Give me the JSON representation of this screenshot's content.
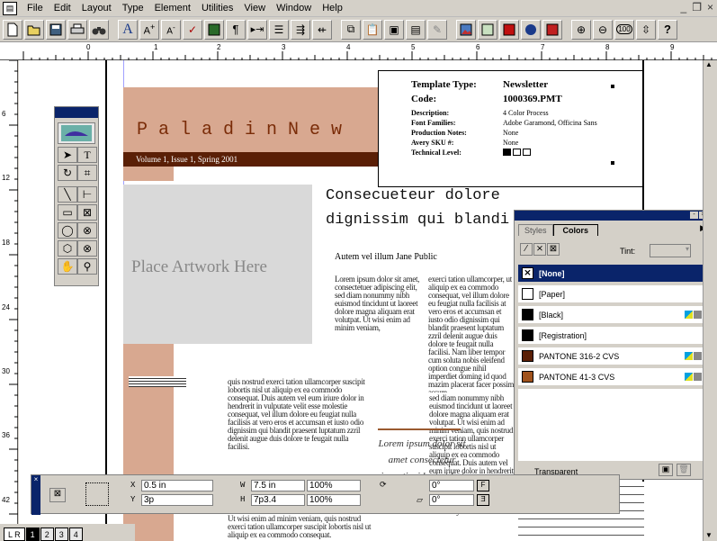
{
  "menubar": {
    "items": [
      "File",
      "Edit",
      "Layout",
      "Type",
      "Element",
      "Utilities",
      "View",
      "Window",
      "Help"
    ],
    "window_controls": [
      "_",
      "❐",
      "×"
    ]
  },
  "toolbar": {
    "buttons": [
      "new-document",
      "open",
      "save",
      "print",
      "find",
      "font",
      "increase-size",
      "decrease-size",
      "spelling",
      "frame",
      "paragraph-mark",
      "tab",
      "list",
      "indent",
      "outdent",
      "copy",
      "paste",
      "view",
      "layers",
      "magnify-1",
      "link",
      "image",
      "color",
      "record",
      "zoom-in",
      "zoom-out",
      "100",
      "navigate",
      "help"
    ],
    "zoom_label": "100",
    "help_label": "?"
  },
  "ruler": {
    "h_labels": [
      "0",
      "1",
      "2",
      "3",
      "4",
      "5",
      "6",
      "7",
      "8",
      "9"
    ],
    "v_labels": [
      "6",
      "12",
      "18",
      "24",
      "30",
      "36",
      "42"
    ]
  },
  "document": {
    "masthead": "PaladinNew",
    "issue_line": "Volume 1, Issue 1, Spring 2001",
    "art_placeholder": "Place Artwork Here",
    "headline_1": "Consecueteur dolore",
    "headline_2": "dignissim qui blandi",
    "byline": "Autem vel illum Jane Public",
    "greek_col1": "Lorem ipsum dolor sit amet, consectetuer adipiscing elit, sed diam nonummy nibh euismod tincidunt ut laoreet dolore magna aliquam erat volutpat. Ut wisi enim ad minim veniam,",
    "greek_col2": "exerci tation ullamcorper, ut aliquip ex ea commodo consequat, vel illum dolore eu feugiat nulla facilisis at vero eros et accumsan et iusto odio dignissim qui blandit praesent luptatum zzril delenit augue duis dolore te feugait nulla facilisi. Nam liber tempor cum soluta nobis eleifend option congue nihil imperdiet doming id quod mazim placerat facer possim assum.",
    "greek_col3": "quis nostrud exerci tation ullamcorper suscipit lobortis nisl ut aliquip ex ea commodo consequat. Duis autem vel eum iriure dolor in hendrerit in vulputate velit esse molestie consequat, vel illum dolore eu feugiat nulla facilisis at vero eros et accumsan et iusto odio dignissim qui blandit praesent luptatum zzril delenit augue duis dolore te feugait nulla facilisi.",
    "greek_col4": "Ut wisi enim ad minim veniam, quis nostrud exerci tation ullamcorper suscipit lobortis nisl ut aliquip ex ea commodo consequat.",
    "pull_quote": "Lorem ipsum dolor sit amet consectetur irure tincidunt ut la /",
    "greek_right": "sed diam nonummy nibh euismod tincidunt ut laoreet dolore magna aliquam erat volutpat. Ut wisi enim ad minim veniam, quis nostrud exerci tation ullamcorper suscipit lobortis nisl ut aliquip ex ea commodo consequat. Duis autem vel eum iriure dolor in hendrerit in vulputate velit esse molestie, vel illum dolore eu feugiat nulla facilisis adipiscing elit, sed diam nonummy nibh euismod"
  },
  "template_info": {
    "labels": [
      "Template Type:",
      "Code:",
      "Description:",
      "Font Families:",
      "Production Notes:",
      "Avery SKU #:",
      "Technical Level:"
    ],
    "values": [
      "Newsletter",
      "1000369.PMT",
      "4 Color Process",
      "Adobe Garamond, Officina Sans",
      "None",
      "None",
      ""
    ]
  },
  "colors_palette": {
    "tabs": [
      "Styles",
      "Colors"
    ],
    "tint_label": "Tint:",
    "swatches": [
      {
        "name": "[None]",
        "color": "#ffffff",
        "selected": true
      },
      {
        "name": "[Paper]",
        "color": "#ffffff",
        "selected": false
      },
      {
        "name": "[Black]",
        "color": "#000000",
        "selected": false
      },
      {
        "name": "[Registration]",
        "color": "#000000",
        "selected": false
      },
      {
        "name": "PANTONE 316-2 CVS",
        "color": "#5a1f06",
        "selected": false
      },
      {
        "name": "PANTONE 41-3 CVS",
        "color": "#a0521c",
        "selected": false
      }
    ],
    "footer_label": "Transparent",
    "accent_selected": "#0a246a"
  },
  "measurements": {
    "x_label": "X",
    "x_value": "0.5 in",
    "y_label": "Y",
    "y_value": "3p",
    "w_label": "W",
    "w_value": "7.5 in",
    "h_label": "H",
    "h_value": "7p3.4",
    "scale_x": "100%",
    "scale_y": "100%",
    "angle": "0°",
    "skew": "0°"
  },
  "page_tabs": [
    "1",
    "2",
    "3",
    "4"
  ]
}
